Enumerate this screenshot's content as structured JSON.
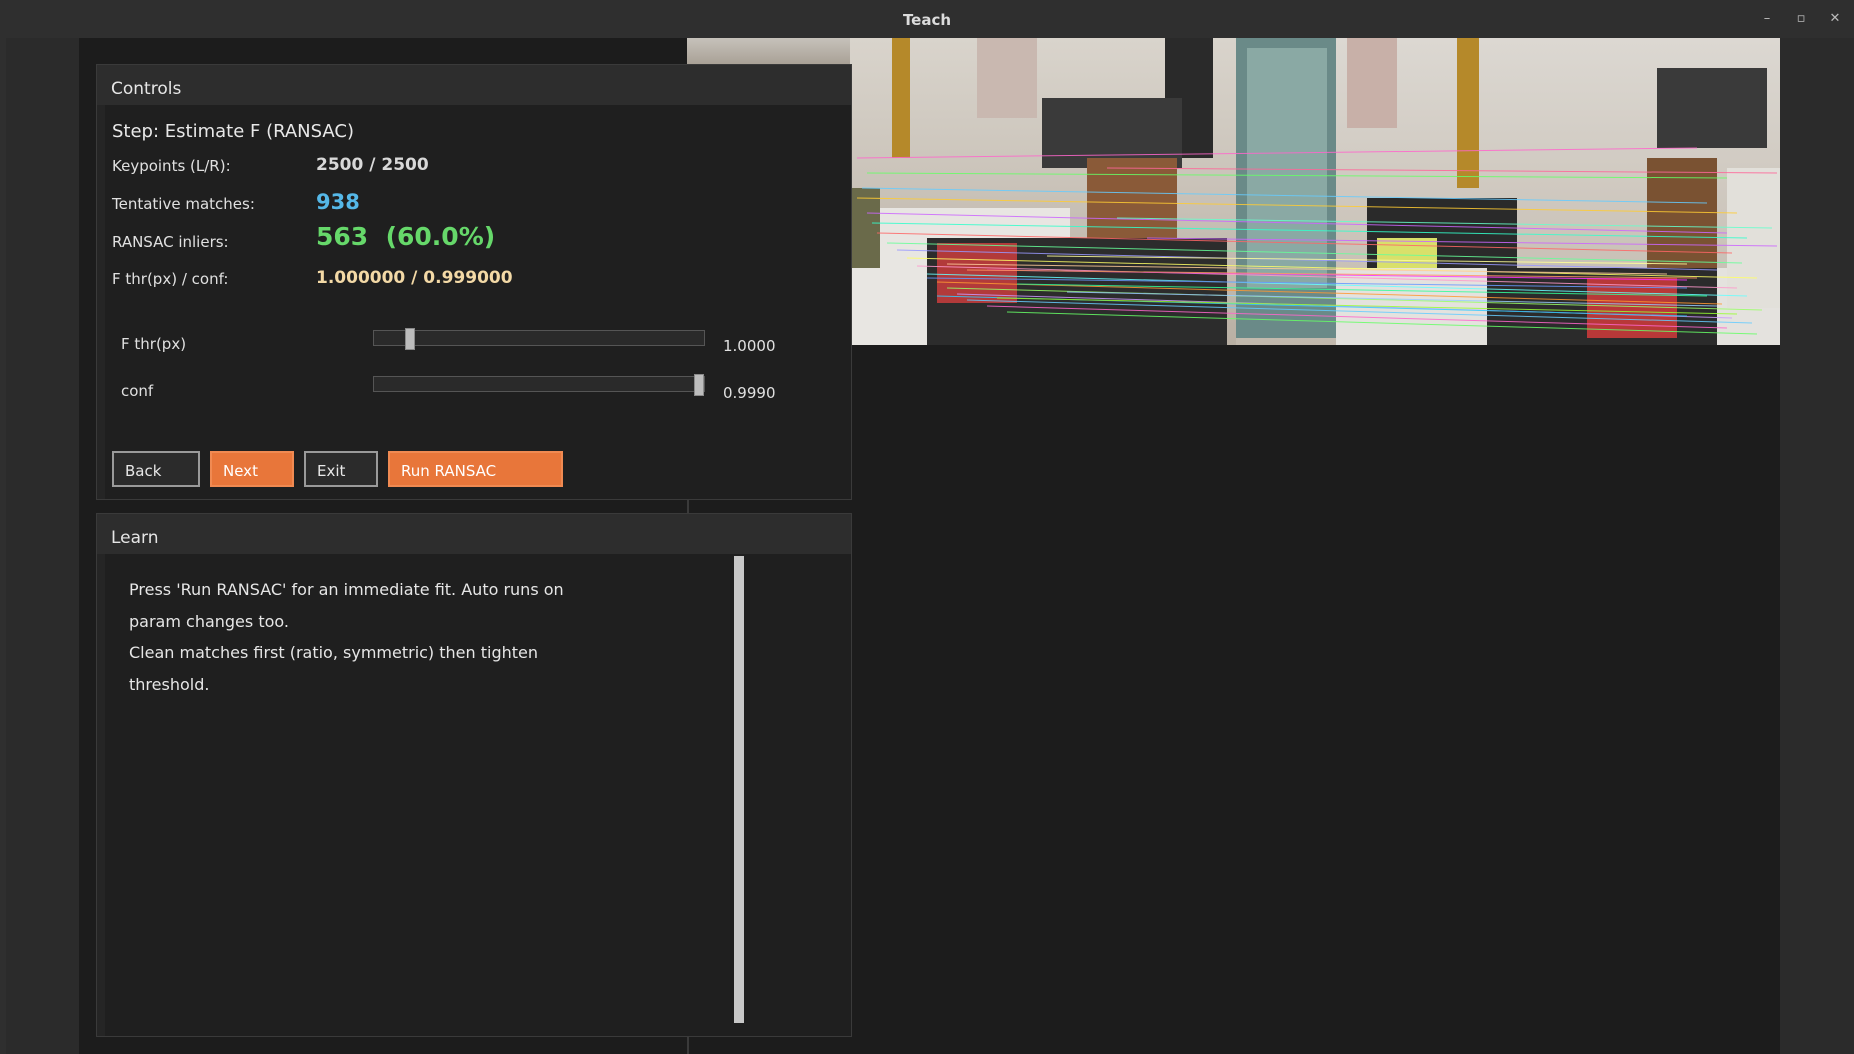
{
  "window": {
    "title": "Teach",
    "minimize_glyph": "–",
    "restore_glyph": "▫",
    "close_glyph": "✕"
  },
  "controls": {
    "header": "Controls",
    "step_title": "Step: Estimate F (RANSAC)",
    "stats": [
      {
        "label": "Keypoints (L/R):",
        "value": "2500 / 2500",
        "color": "#d8d8d8"
      },
      {
        "label": "Tentative matches:",
        "value": "938",
        "color": "#55b8e8"
      },
      {
        "label": "RANSAC inliers:",
        "value": "563  (60.0%)",
        "color": "#66d86a"
      },
      {
        "label": "F thr(px) / conf:",
        "value": "1.000000 / 0.999000",
        "color": "#f3d9a6"
      }
    ],
    "sliders": [
      {
        "label": "F thr(px)",
        "value_text": "1.0000",
        "level": 0.1
      },
      {
        "label": "conf",
        "value_text": "0.9990",
        "level": 1.0
      }
    ],
    "buttons": {
      "back": "Back",
      "next": "Next",
      "exit": "Exit",
      "run": "Run RANSAC"
    }
  },
  "learn": {
    "header": "Learn",
    "lines": [
      "Press 'Run RANSAC' for an immediate fit. Auto runs on",
      "param changes too.",
      "Clean matches first (ratio, symmetric) then tighten",
      "threshold."
    ]
  },
  "colors": {
    "accent": "#e8763a",
    "matches": "#55b8e8",
    "inliers": "#66d86a",
    "params": "#f3d9a6"
  }
}
